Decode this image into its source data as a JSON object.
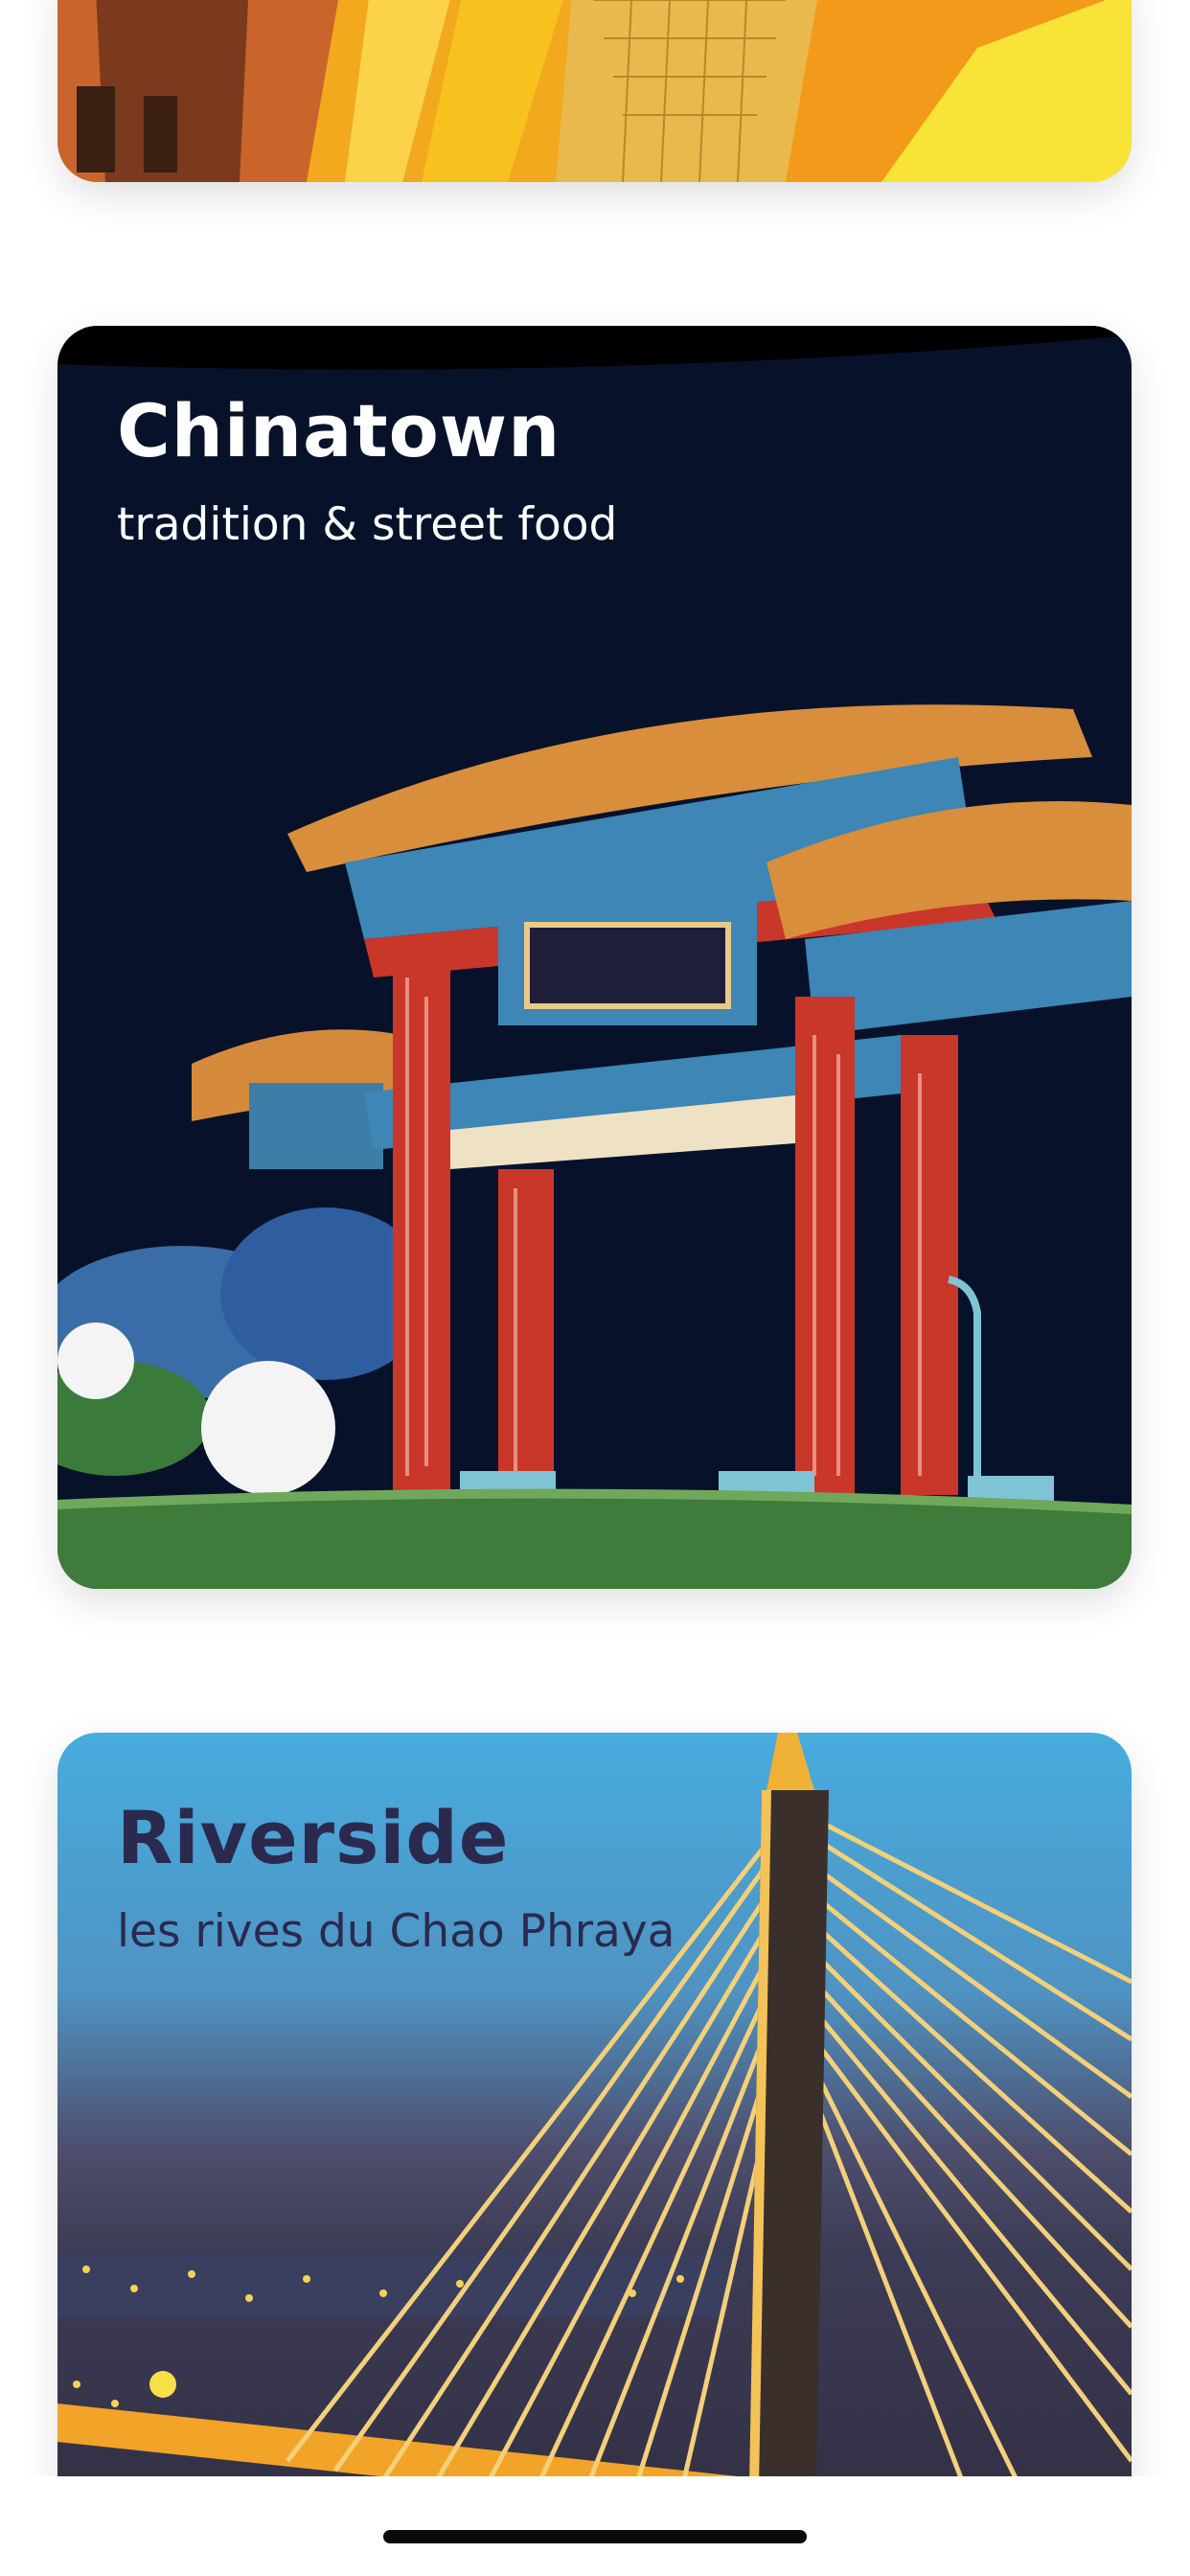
{
  "cards": [
    {
      "id": "top",
      "title": "",
      "subtitle": "",
      "art": "golden-temple-illustration"
    },
    {
      "id": "chinatown",
      "title": "Chinatown",
      "subtitle": "tradition & street food",
      "art": "chinatown-gate-illustration",
      "colors": {
        "sky": "#07122a",
        "pillar": "#c8372a",
        "roof": "#3d86b5",
        "grass": "#3f7b3a"
      }
    },
    {
      "id": "riverside",
      "title": "Riverside",
      "subtitle": "les rives du Chao Phraya",
      "art": "rama-viii-bridge-illustration",
      "colors": {
        "sky": "#4aa9dc",
        "tower": "#3a2f2a",
        "cable": "#f3d07a"
      }
    }
  ]
}
